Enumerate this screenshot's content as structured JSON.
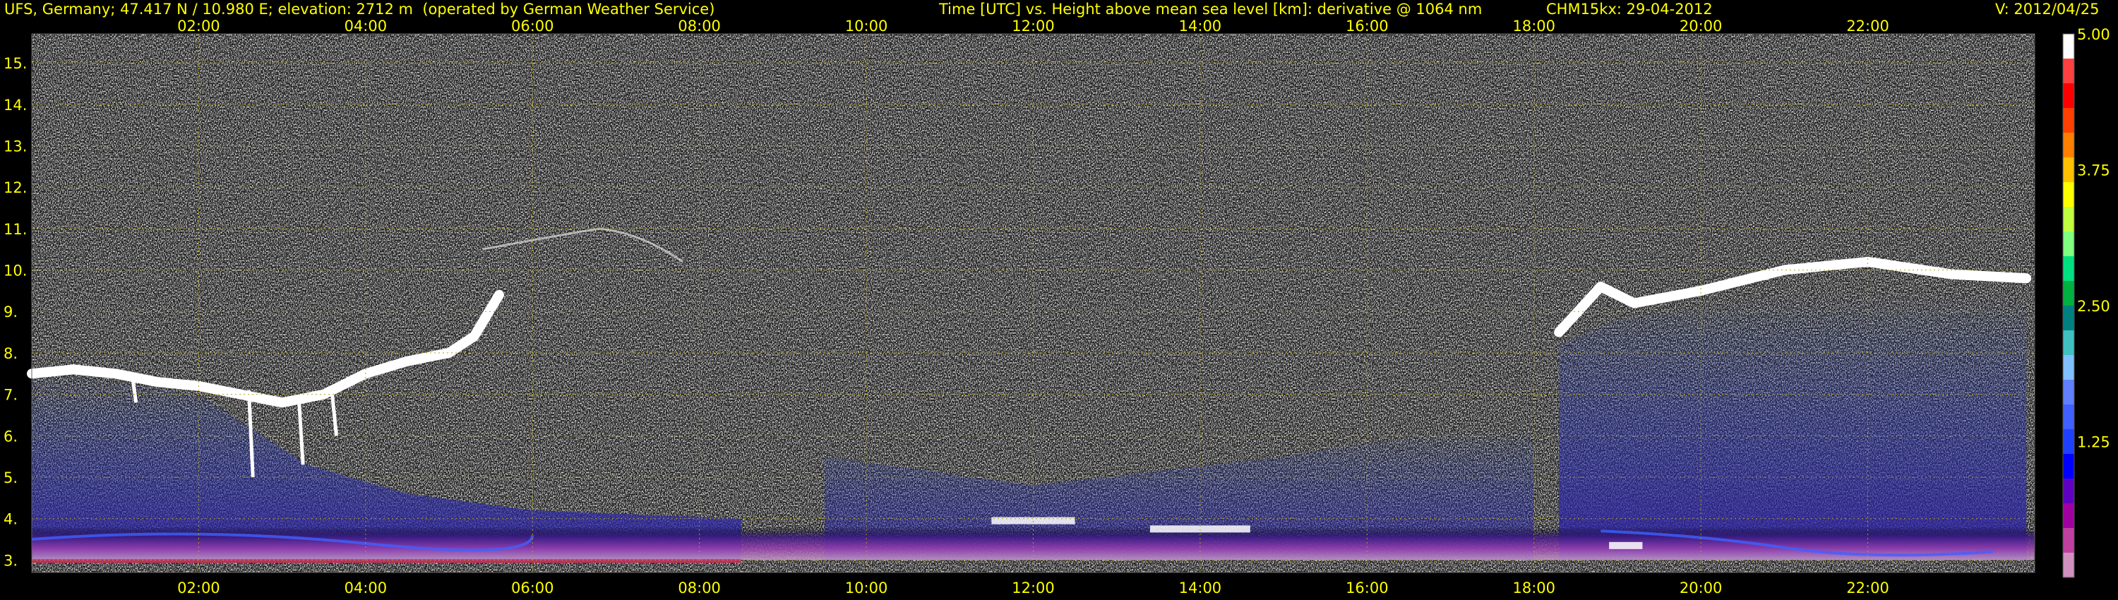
{
  "header": {
    "station": "UFS, Germany; 47.417 N / 10.980 E; elevation: 2712 m  (operated by German Weather Service)",
    "axes_desc": "Time [UTC] vs. Height above mean sea level [km]: derivative @ 1064 nm",
    "instrument_date": "CHM15kx: 29-04-2012",
    "version": "V: 2012/04/25"
  },
  "chart_data": {
    "type": "heatmap",
    "title": "Time [UTC] vs. Height above mean sea level [km]: derivative @ 1064 nm",
    "xlabel": "Time [UTC]",
    "ylabel": "Height above mean sea level [km]",
    "xlim": [
      0,
      24
    ],
    "ylim": [
      2.7,
      15.7
    ],
    "x_ticks": [
      "02:00",
      "04:00",
      "06:00",
      "08:00",
      "10:00",
      "12:00",
      "14:00",
      "16:00",
      "18:00",
      "20:00",
      "22:00"
    ],
    "x_tick_values": [
      2,
      4,
      6,
      8,
      10,
      12,
      14,
      16,
      18,
      20,
      22
    ],
    "y_ticks": [
      "3.",
      "4.",
      "5.",
      "6.",
      "7.",
      "8.",
      "9.",
      "10.",
      "11.",
      "12.",
      "13.",
      "14.",
      "15."
    ],
    "y_tick_values": [
      3,
      4,
      5,
      6,
      7,
      8,
      9,
      10,
      11,
      12,
      13,
      14,
      15
    ],
    "grid": true,
    "colorbar": {
      "range": [
        0,
        5
      ],
      "labels": [
        "5.00",
        "3.75",
        "2.50",
        "1.25"
      ],
      "label_values": [
        5.0,
        3.75,
        2.5,
        1.25
      ],
      "colors": [
        "#ffffff",
        "#ff4040",
        "#ff0000",
        "#ff4000",
        "#ff8000",
        "#ffc000",
        "#ffff00",
        "#c0ff40",
        "#80ff80",
        "#00e080",
        "#00b040",
        "#008080",
        "#40c0c0",
        "#80c0ff",
        "#6080ff",
        "#4060ff",
        "#2040ff",
        "#0000ff",
        "#6000c0",
        "#a000a0",
        "#c040a0",
        "#d090c0"
      ]
    },
    "cloud_layers": [
      {
        "name": "cloud-layer-morning",
        "points": [
          [
            0,
            7.5
          ],
          [
            0.5,
            7.6
          ],
          [
            1,
            7.5
          ],
          [
            1.5,
            7.3
          ],
          [
            2,
            7.2
          ],
          [
            2.5,
            7.0
          ],
          [
            3,
            6.8
          ],
          [
            3.5,
            7.0
          ],
          [
            4,
            7.5
          ],
          [
            4.5,
            7.8
          ],
          [
            5,
            8.0
          ],
          [
            5.3,
            8.4
          ],
          [
            5.6,
            9.4
          ]
        ]
      },
      {
        "name": "cloud-layer-evening",
        "points": [
          [
            18.3,
            8.5
          ],
          [
            18.8,
            9.6
          ],
          [
            19.2,
            9.2
          ],
          [
            20,
            9.5
          ],
          [
            21,
            10.0
          ],
          [
            22,
            10.2
          ],
          [
            23,
            9.9
          ],
          [
            23.9,
            9.8
          ]
        ]
      }
    ],
    "aerosol_layer": {
      "base_km": 3.0,
      "top_km": 3.8
    }
  }
}
